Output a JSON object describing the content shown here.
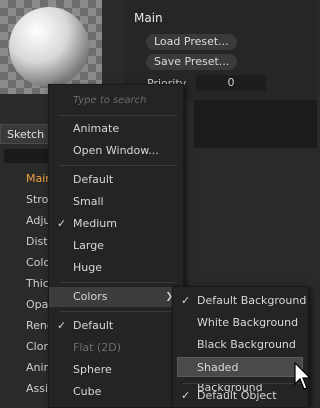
{
  "panel": {
    "title": "Main",
    "load_preset": "Load Preset...",
    "save_preset": "Save Preset...",
    "priority_label": "Priority",
    "priority_value": "0"
  },
  "left": {
    "tab": "Sketch M",
    "items": [
      "Main",
      "Strok",
      "Adju",
      "Disto",
      "Colo",
      "Thick",
      "Opa",
      "Renc",
      "Clon",
      "Anim",
      "Assig"
    ]
  },
  "menu": {
    "search_placeholder": "Type to search",
    "items": {
      "animate": "Animate",
      "open_window": "Open Window...",
      "default": "Default",
      "small": "Small",
      "medium": "Medium",
      "large": "Large",
      "huge": "Huge",
      "colors": "Colors",
      "default2": "Default",
      "flat2d": "Flat (2D)",
      "sphere": "Sphere",
      "cube": "Cube"
    }
  },
  "submenu": {
    "items": {
      "default_bg": "Default Background",
      "white_bg": "White Background",
      "black_bg": "Black Background",
      "shaded_bg": "Shaded Background",
      "default_obj": "Default Object"
    }
  },
  "colors": {
    "accent": "#f2a344",
    "menu_bg": "#242424",
    "highlight": "#3d3d3d"
  }
}
